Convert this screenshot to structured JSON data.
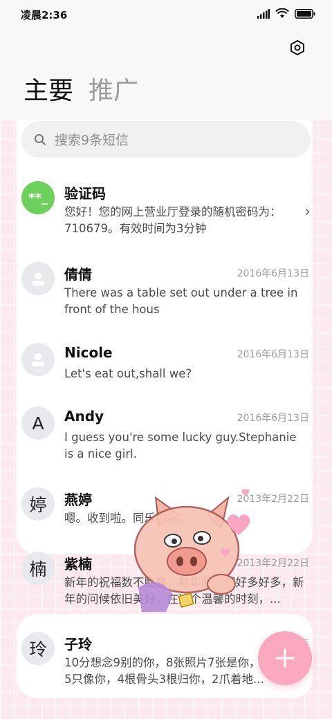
{
  "status_bar": {
    "time": "凌晨2:36"
  },
  "tabs": {
    "main": "主要",
    "promo": "推广"
  },
  "search": {
    "placeholder": "搜索9条短信"
  },
  "messages": [
    {
      "avatar": "**_",
      "name": "验证码",
      "date": "",
      "preview": "您好！您的网上营业厅登录的随机密码为：710679。有效时间为3分钟"
    },
    {
      "avatar": "",
      "name": "倩倩",
      "date": "2016年6月13日",
      "preview": "There was a table set out under a tree in front of the hous"
    },
    {
      "avatar": "",
      "name": "Nicole",
      "date": "2016年6月13日",
      "preview": "Let's eat out,shall we?"
    },
    {
      "avatar": "A",
      "name": "Andy",
      "date": "2016年6月13日",
      "preview": "I guess you're some lucky guy.Stephanie is a nice girl."
    },
    {
      "avatar": "婷",
      "name": "燕婷",
      "date": "2013年2月22日",
      "preview": "嗯。收到啦。同乐同乐。"
    },
    {
      "avatar": "楠",
      "name": "紫楠",
      "date": "2013年2月22日",
      "preview": "新年的祝福数不胜数，新年的愿望好多好多，新年的问候依旧美好，在这个温馨的时刻，..."
    },
    {
      "avatar": "玲",
      "name": "子玲",
      "date": "2013年",
      "preview": "10分想念9别的你，8张照片7张是你，6只小狗5只像你，4根骨头3根归你，2爪着地..."
    }
  ],
  "colors": {
    "accent": "#f9a8bd",
    "verify_avatar": "#6dd05c",
    "background": "#fbe9ed"
  },
  "icons": {
    "settings": "settings-hexagon-icon",
    "search": "search-icon",
    "fab": "plus-icon"
  }
}
